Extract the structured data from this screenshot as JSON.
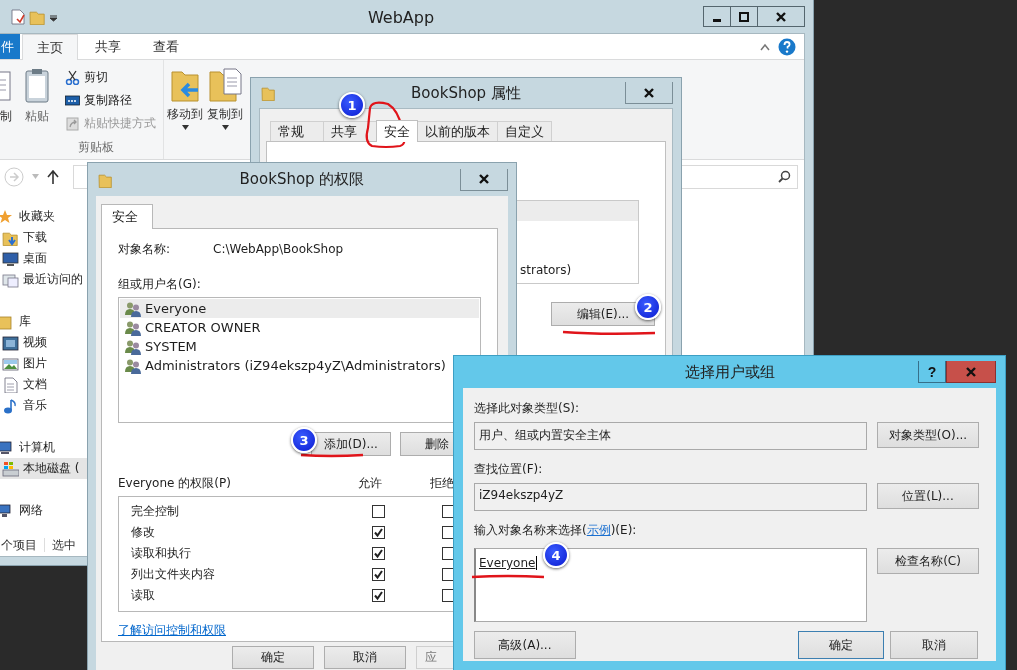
{
  "explorer": {
    "title": "WebApp",
    "ribbon_tabs": [
      {
        "label": "件",
        "selected": false,
        "kind": "file"
      },
      {
        "label": "主页",
        "selected": true,
        "kind": "tab"
      },
      {
        "label": "共享",
        "selected": false,
        "kind": "tab"
      },
      {
        "label": "查看",
        "selected": false,
        "kind": "tab"
      }
    ],
    "clipboard": {
      "copy": "制",
      "paste": "粘贴",
      "small": [
        {
          "label": "剪切",
          "disabled": false,
          "kind": "scissors"
        },
        {
          "label": "复制路径",
          "disabled": false,
          "kind": "path"
        },
        {
          "label": "粘贴快捷方式",
          "disabled": true,
          "kind": "shortcut"
        }
      ],
      "group_label": "剪贴板"
    },
    "organize": [
      {
        "label": "移动到",
        "kind": "move"
      },
      {
        "label": "复制到",
        "kind": "copy"
      }
    ],
    "sidebar": [
      {
        "label": "收藏夹",
        "kind": "star",
        "selected": false,
        "children": [
          {
            "label": "下载",
            "kind": "download",
            "selected": false
          },
          {
            "label": "桌面",
            "kind": "desktop",
            "selected": false
          },
          {
            "label": "最近访问的",
            "kind": "recent",
            "selected": false
          }
        ]
      },
      {
        "label": "库",
        "kind": "library",
        "selected": false,
        "children": [
          {
            "label": "视频",
            "kind": "video",
            "selected": false
          },
          {
            "label": "图片",
            "kind": "picture",
            "selected": false
          },
          {
            "label": "文档",
            "kind": "document",
            "selected": false
          },
          {
            "label": "音乐",
            "kind": "music",
            "selected": false
          }
        ]
      },
      {
        "label": "计算机",
        "kind": "computer",
        "selected": false,
        "children": [
          {
            "label": "本地磁盘 (",
            "kind": "drive",
            "selected": true
          }
        ]
      },
      {
        "label": "网络",
        "kind": "network",
        "selected": false
      }
    ],
    "status": {
      "count": "个项目",
      "selection": "选中"
    }
  },
  "properties": {
    "title": "BookShop 属性",
    "tabs": [
      {
        "label": "常规",
        "selected": false
      },
      {
        "label": "共享",
        "selected": false
      },
      {
        "label": "安全",
        "selected": true
      },
      {
        "label": "以前的版本",
        "selected": false
      },
      {
        "label": "自定义",
        "selected": false
      }
    ],
    "group_tail": "strators)",
    "edit_button": "编辑(E)..."
  },
  "permissions": {
    "title": "BookShop 的权限",
    "tab": {
      "label": "安全",
      "selected": true
    },
    "object_label": "对象名称:",
    "object_value": "C:\\WebApp\\BookShop",
    "groups_label": "组或用户名(G):",
    "groups": [
      {
        "name": "Everyone",
        "selected": true
      },
      {
        "name": "CREATOR OWNER",
        "selected": false
      },
      {
        "name": "SYSTEM",
        "selected": false
      },
      {
        "name": "Administrators (iZ94ekszp4yZ\\Administrators)",
        "selected": false
      }
    ],
    "add_button": "添加(D)...",
    "remove_button": "删除",
    "perm_label": "Everyone 的权限(P)",
    "allow_header": "允许",
    "deny_header": "拒绝",
    "entries": [
      {
        "name": "完全控制",
        "allow": false,
        "deny": false
      },
      {
        "name": "修改",
        "allow": true,
        "deny": false
      },
      {
        "name": "读取和执行",
        "allow": true,
        "deny": false
      },
      {
        "name": "列出文件夹内容",
        "allow": true,
        "deny": false
      },
      {
        "name": "读取",
        "allow": true,
        "deny": false
      }
    ],
    "help_link": "了解访问控制和权限",
    "buttons": [
      {
        "label": "确定",
        "disabled": false
      },
      {
        "label": "取消",
        "disabled": false
      },
      {
        "label": "应",
        "disabled": true
      }
    ]
  },
  "select_dialog": {
    "title": "选择用户或组",
    "help": "?",
    "types_label": "选择此对象类型(S):",
    "types_value": "用户、组或内置安全主体",
    "types_button": "对象类型(O)...",
    "location_label": "查找位置(F):",
    "location_value": "iZ94ekszp4yZ",
    "location_button": "位置(L)...",
    "names_label_before": "输入对象名称来选择(",
    "names_link": "示例",
    "names_label_after": ")(E):",
    "names_value": "Everyone",
    "check_button": "检查名称(C)",
    "advanced_button": "高级(A)...",
    "ok_button": "确定",
    "cancel_button": "取消"
  },
  "annotations": [
    {
      "label": "1"
    },
    {
      "label": "2"
    },
    {
      "label": "3"
    },
    {
      "label": "4"
    }
  ]
}
